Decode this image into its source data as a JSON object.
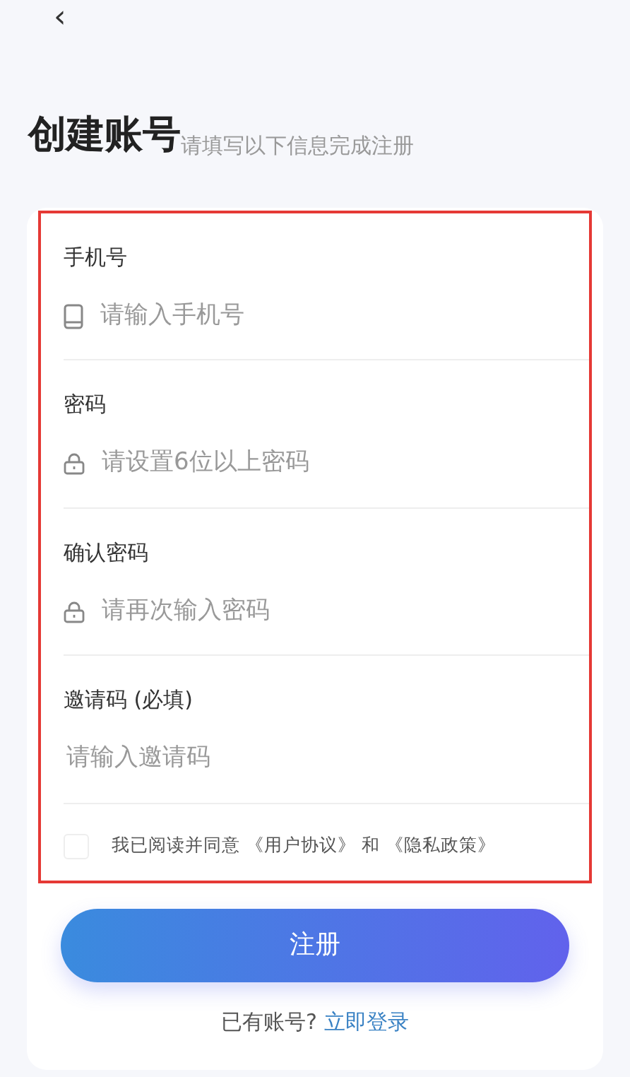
{
  "back_button": {
    "label": "‹"
  },
  "title": "创建账号",
  "subtitle": "请填写以下信息完成注册",
  "form": {
    "highlighted": true,
    "fields": [
      {
        "label": "手机号",
        "kind": "phone",
        "placeholder": "请输入手机号"
      },
      {
        "label": "密码",
        "kind": "lock",
        "placeholder": "请设置6位以上密码"
      },
      {
        "label": "确认密码",
        "kind": "lock",
        "placeholder": "请再次输入密码"
      },
      {
        "label": "邀请码 (必填)",
        "kind": "plain",
        "placeholder": "请输入邀请码"
      }
    ],
    "agreement": {
      "checked": false,
      "text": "我已阅读并同意 《用户协议》 和 《隐私政策》"
    }
  },
  "submit_button": "注册",
  "login_prompt": {
    "text": "已有账号?",
    "link": "立即登录"
  }
}
